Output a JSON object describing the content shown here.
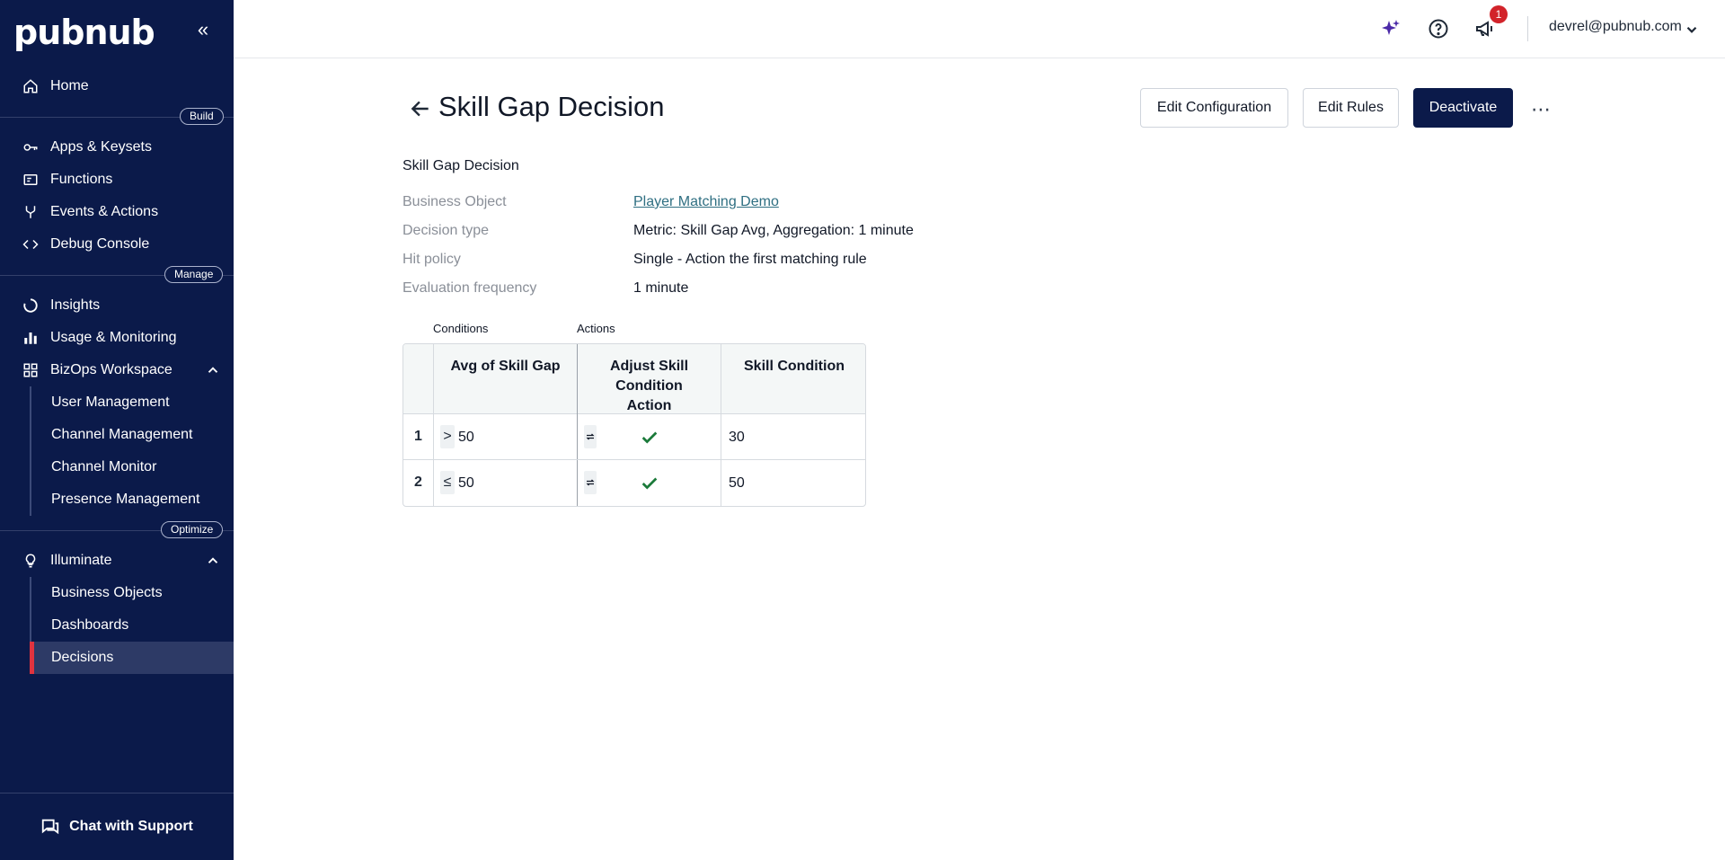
{
  "app": {
    "logo": "pubnub",
    "collapse_glyph": "«"
  },
  "colors": {
    "sidebar_bg": "#0b1a4a",
    "accent_active": "#e0333f",
    "badge": "#d2232a",
    "check": "#1b7a3a",
    "link": "#2f6f82"
  },
  "sidebar": {
    "home": "Home",
    "build_pill": "Build",
    "build_items": [
      "Apps & Keysets",
      "Functions",
      "Events & Actions",
      "Debug Console"
    ],
    "manage_pill": "Manage",
    "manage_items": [
      "Insights",
      "Usage & Monitoring"
    ],
    "bizops": {
      "label": "BizOps Workspace",
      "children": [
        "User Management",
        "Channel Management",
        "Channel Monitor",
        "Presence Management"
      ]
    },
    "optimize_pill": "Optimize",
    "illuminate": {
      "label": "Illuminate",
      "children": [
        "Business Objects",
        "Dashboards",
        "Decisions"
      ],
      "active": "Decisions"
    },
    "support": "Chat with Support"
  },
  "topbar": {
    "notification_count": "1",
    "user_email": "devrel@pubnub.com",
    "icons": [
      "sparkle-icon",
      "help-icon",
      "megaphone-icon"
    ]
  },
  "page": {
    "title": "Skill Gap Decision",
    "buttons": {
      "edit_config": "Edit Configuration",
      "edit_rules": "Edit Rules",
      "deactivate": "Deactivate"
    },
    "more": "⋯",
    "subtitle": "Skill Gap Decision",
    "details": [
      {
        "key": "Business Object",
        "value": "Player Matching Demo",
        "link": true
      },
      {
        "key": "Decision type",
        "value": "Metric: Skill Gap Avg, Aggregation: 1 minute"
      },
      {
        "key": "Hit policy",
        "value": "Single - Action the first matching rule"
      },
      {
        "key": "Evaluation frequency",
        "value": "1 minute"
      }
    ]
  },
  "table": {
    "groups": {
      "conditions": "Conditions",
      "actions": "Actions"
    },
    "headers": [
      "Avg of Skill Gap",
      "Adjust Skill Condition Action",
      "Skill Condition"
    ],
    "rows": [
      {
        "num": "1",
        "op": ">",
        "value": "50",
        "action_enabled": true,
        "skill": "30"
      },
      {
        "num": "2",
        "op": "≤",
        "value": "50",
        "action_enabled": true,
        "skill": "50"
      }
    ]
  }
}
